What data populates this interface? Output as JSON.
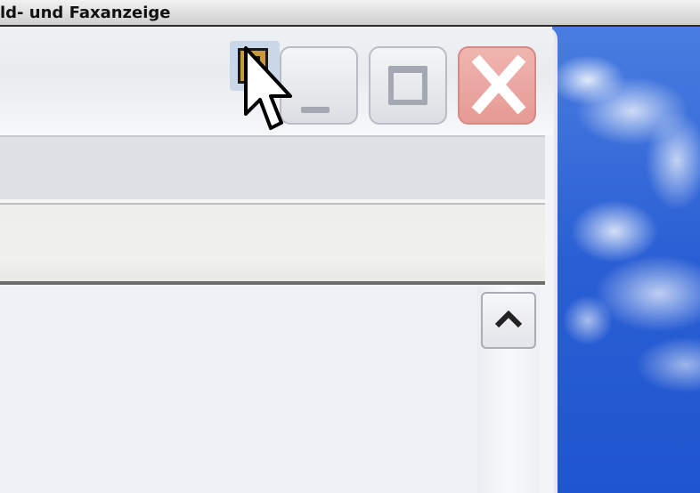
{
  "background_window": {
    "title": "ld- und Faxanzeige"
  },
  "window": {
    "caption_buttons": [
      "minimize",
      "maximize",
      "close"
    ]
  },
  "icons": {
    "app_icon": "app-icon",
    "cursor": "mouse-pointer-icon",
    "minimize": "minimize-icon",
    "maximize": "maximize-icon",
    "close": "close-icon",
    "scroll_up": "chevron-up-icon"
  },
  "colors": {
    "close_button": "#e69a94",
    "desktop_sky": "#2f64d8",
    "window_bg": "#f3f4f7"
  }
}
